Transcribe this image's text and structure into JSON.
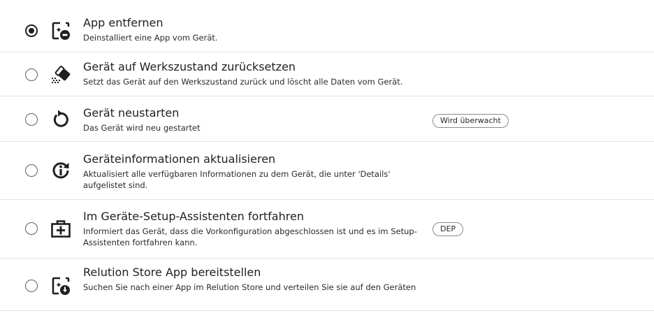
{
  "actions": [
    {
      "title": "App entfernen",
      "description": "Deinstalliert eine App vom Gerät.",
      "selected": true,
      "icon": "app-remove-icon",
      "badge": ""
    },
    {
      "title": "Gerät auf Werkszustand zurücksetzen",
      "description": "Setzt das Gerät auf den Werkszustand zurück und löscht alle Daten vom Gerät.",
      "selected": false,
      "icon": "eraser-icon",
      "badge": ""
    },
    {
      "title": "Gerät neustarten",
      "description": "Das Gerät wird neu gestartet",
      "selected": false,
      "icon": "restart-icon",
      "badge": "Wird überwacht"
    },
    {
      "title": "Geräteinformationen aktualisieren",
      "description": "Aktualisiert alle verfügbaren Informationen zu dem Gerät, die unter 'Details' aufgelistet sind.",
      "selected": false,
      "icon": "refresh-info-icon",
      "badge": ""
    },
    {
      "title": "Im Geräte-Setup-Assistenten fortfahren",
      "description": "Informiert das Gerät, dass die Vorkonfiguration abgeschlossen ist und es im Setup-Assistenten fortfahren kann.",
      "selected": false,
      "icon": "setup-assistant-icon",
      "badge": "DEP"
    },
    {
      "title": "Relution Store App bereitstellen",
      "description": "Suchen Sie nach einer App im Relution Store und verteilen Sie sie auf den Geräten",
      "selected": false,
      "icon": "app-deploy-icon",
      "badge": ""
    }
  ]
}
